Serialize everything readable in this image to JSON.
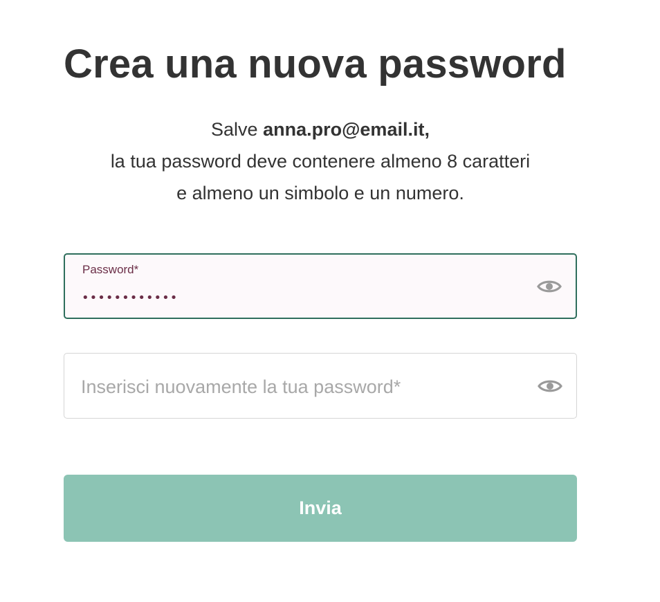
{
  "page": {
    "title": "Crea una nuova password"
  },
  "intro": {
    "greeting": "Salve ",
    "email": "anna.pro@email.it,",
    "line2": "la tua password deve contenere almeno 8 caratteri",
    "line3": "e almeno un simbolo e un numero."
  },
  "password_field": {
    "label": "Password*",
    "value": "••••••••••••",
    "icon": "eye-icon"
  },
  "confirm_field": {
    "placeholder": "Inserisci nuovamente la tua password*",
    "value": "",
    "icon": "eye-icon"
  },
  "submit": {
    "label": "Invia",
    "color": "#8cc4b4"
  },
  "colors": {
    "active_border": "#2e6e5c",
    "label": "#6b2e47",
    "icon": "#9a9a9a"
  }
}
